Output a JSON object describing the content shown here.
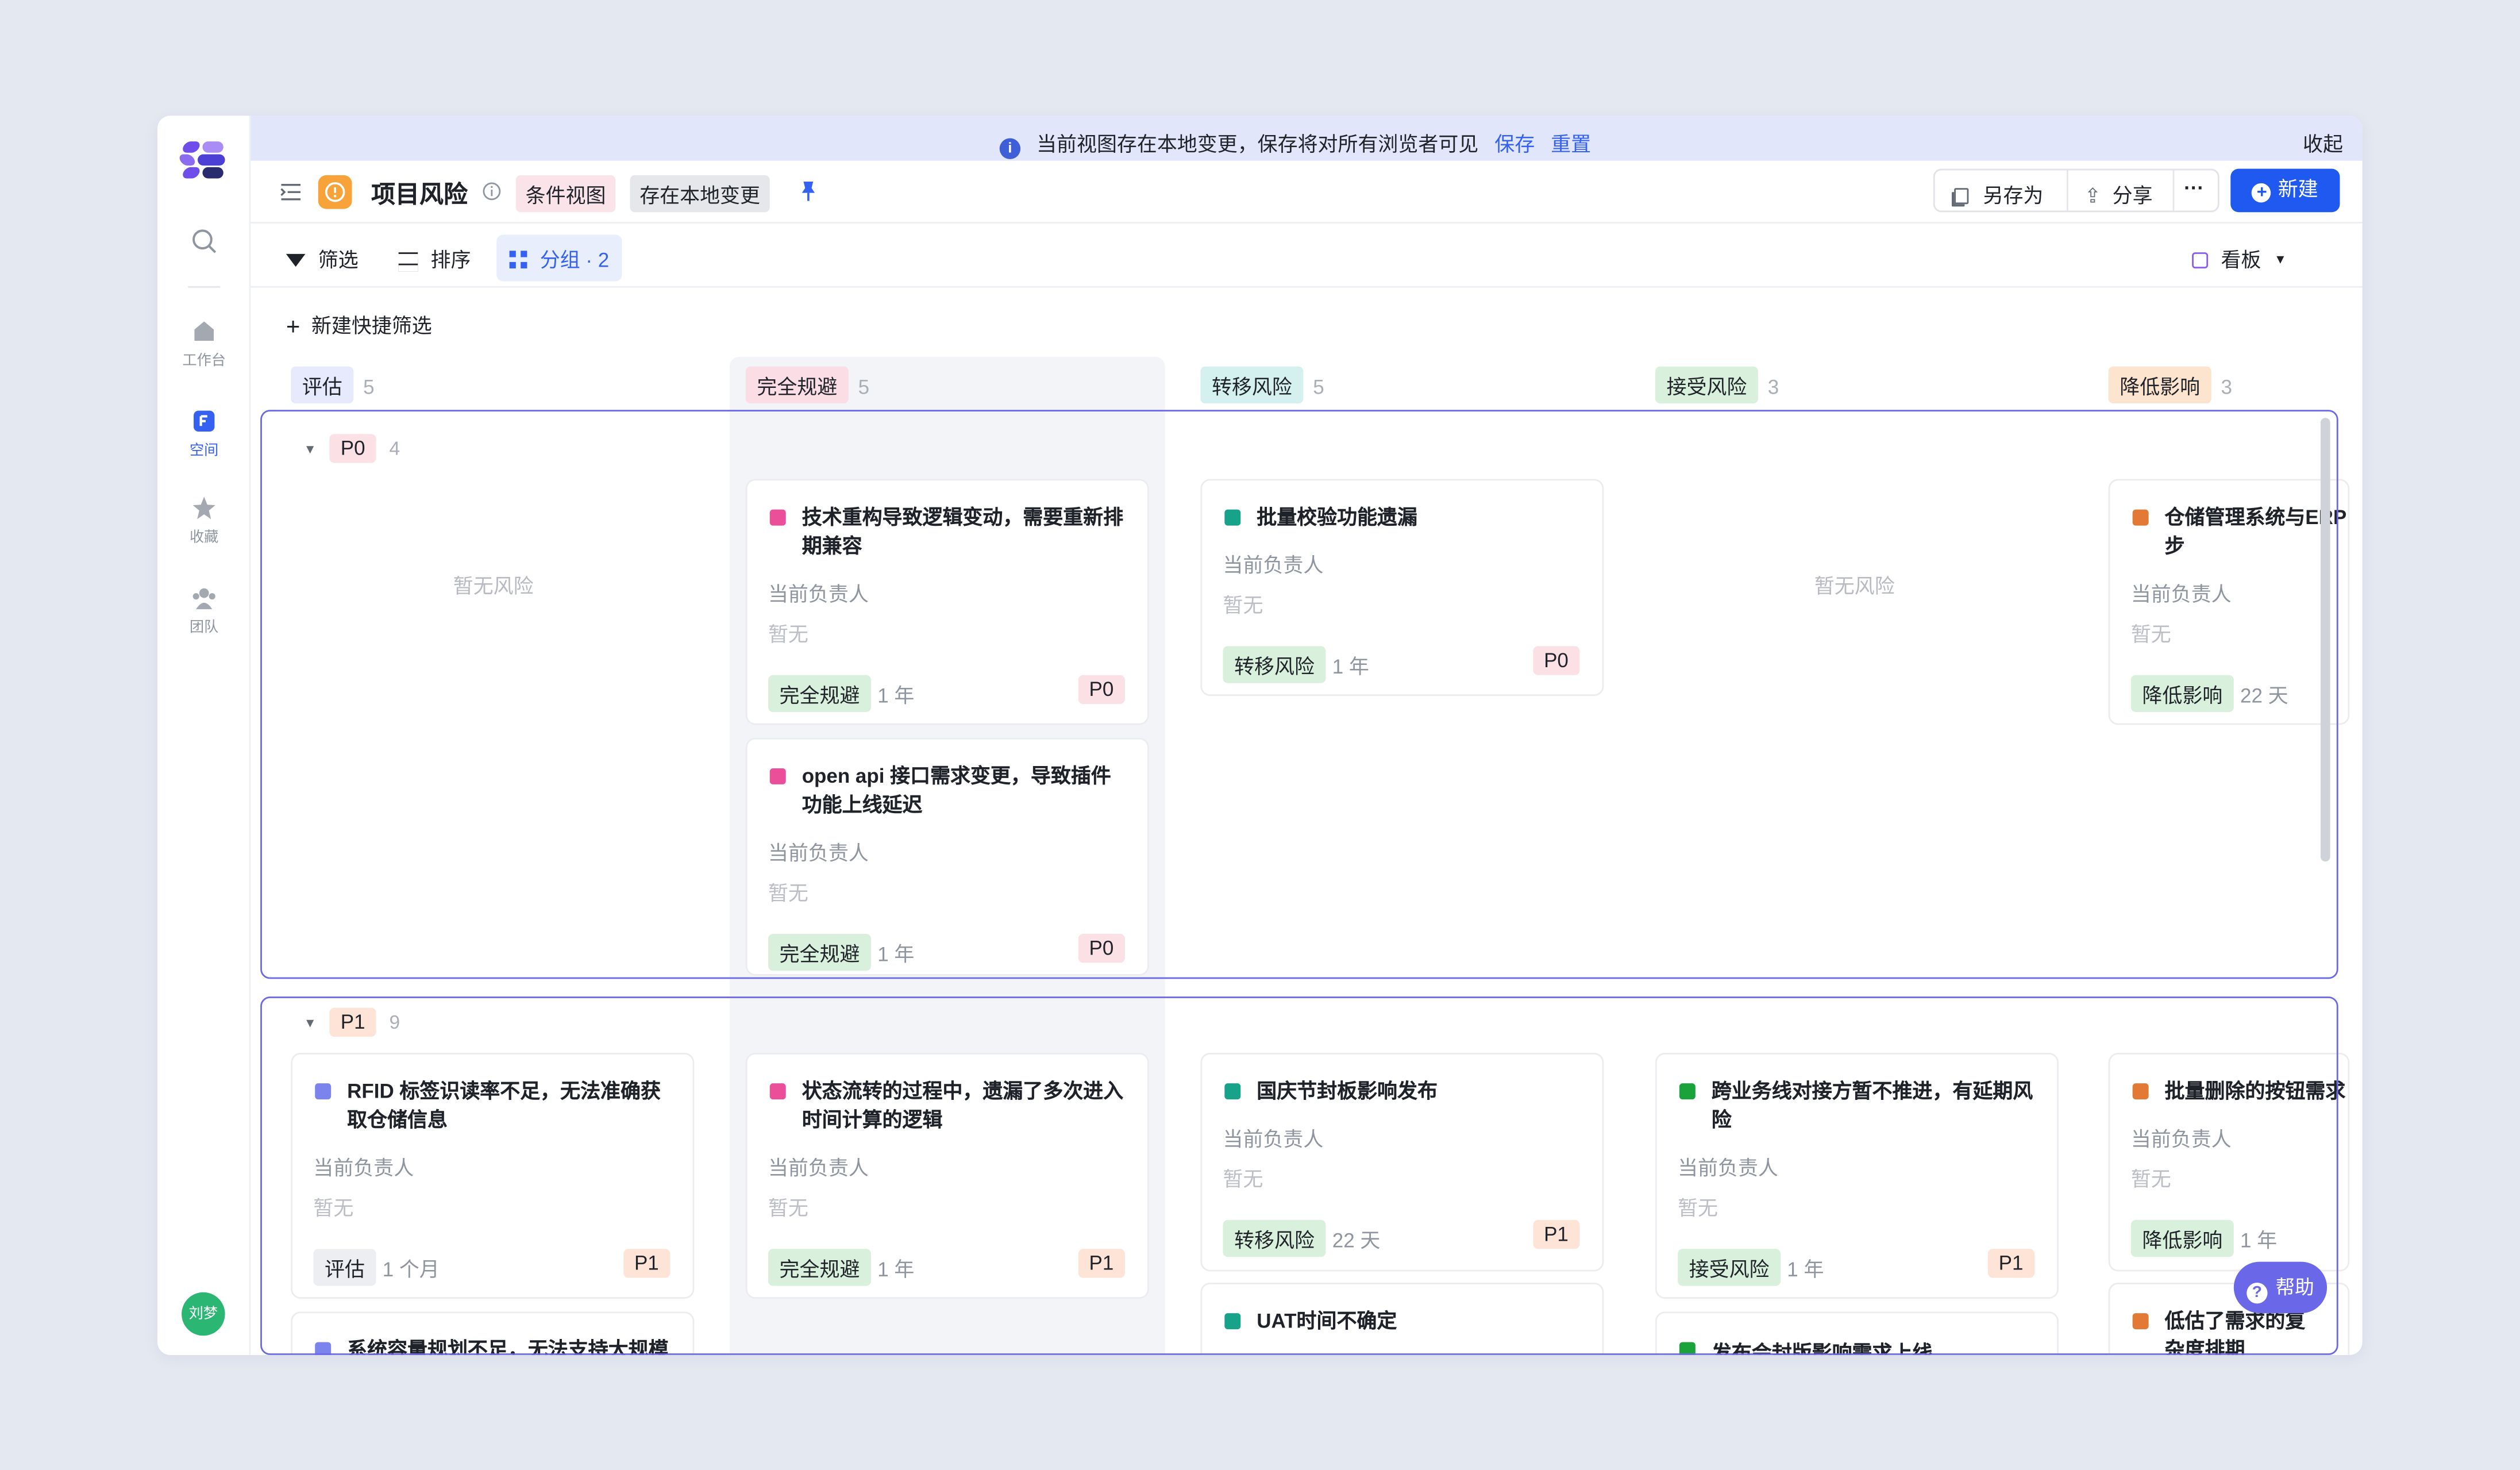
{
  "sidebar": {
    "items": [
      {
        "label": "工作台"
      },
      {
        "label": "空间"
      },
      {
        "label": "收藏"
      },
      {
        "label": "团队"
      }
    ],
    "avatar_label": "刘梦"
  },
  "banner": {
    "message": "当前视图存在本地变更，保存将对所有浏览者可见",
    "save_label": "保存",
    "reset_label": "重置",
    "collapse_label": "收起"
  },
  "header": {
    "title": "项目风险",
    "view_tag": "条件视图",
    "local_change_tag": "存在本地变更",
    "save_as_label": "另存为",
    "share_label": "分享",
    "more_label": "···",
    "new_label": "新建"
  },
  "toolbar": {
    "filter_label": "筛选",
    "sort_label": "排序",
    "group_label": "分组 · 2",
    "view_label": "看板"
  },
  "quick_filter_label": "新建快捷筛选",
  "columns": [
    {
      "name": "评估",
      "count": "5",
      "color": "#e7e9fd"
    },
    {
      "name": "完全规避",
      "count": "5",
      "color": "#fbdde6"
    },
    {
      "name": "转移风险",
      "count": "5",
      "color": "#d5f1ef"
    },
    {
      "name": "接受风险",
      "count": "3",
      "color": "#d9f1dc"
    },
    {
      "name": "降低影响",
      "count": "3",
      "color": "#fde4cf"
    }
  ],
  "groups": [
    {
      "name": "P0",
      "count": "4",
      "color": "#fbe1e6"
    },
    {
      "name": "P1",
      "count": "9",
      "color": "#fde4d6"
    }
  ],
  "empty_label": "暂无风险",
  "owner_label": "当前负责人",
  "owner_empty": "暂无",
  "cards": [
    {
      "title": "技术重构导致逻辑变动，需要重新排期兼容",
      "status": "完全规避",
      "time": "1 年",
      "priority": "P0",
      "dot": "#eb4f9a",
      "status_color": "#d9f1dc"
    },
    {
      "title": "open api 接口需求变更，导致插件功能上线延迟",
      "status": "完全规避",
      "time": "1 年",
      "priority": "P0",
      "dot": "#eb4f9a",
      "status_color": "#d9f1dc"
    },
    {
      "title": "批量校验功能遗漏",
      "status": "转移风险",
      "time": "1 年",
      "priority": "P0",
      "dot": "#17a38a",
      "status_color": "#d9f1dc"
    },
    {
      "title": "仓储管理系统与ERP，无法实现数据同步",
      "status": "降低影响",
      "time": "22 天",
      "priority": "",
      "dot": "#e27a35",
      "status_color": "#d9f1dc"
    },
    {
      "title": "RFID 标签识读率不足，无法准确获取仓储信息",
      "status": "评估",
      "time": "1 个月",
      "priority": "P1",
      "dot": "#7b83ec",
      "status_color": "#eceef2"
    },
    {
      "title": "状态流转的过程中，遗漏了多次进入时间计算的逻辑",
      "status": "完全规避",
      "time": "1 年",
      "priority": "P1",
      "dot": "#eb4f9a",
      "status_color": "#d9f1dc"
    },
    {
      "title": "国庆节封板影响发布",
      "status": "转移风险",
      "time": "22 天",
      "priority": "P1",
      "dot": "#17a38a",
      "status_color": "#d9f1dc"
    },
    {
      "title": "跨业务线对接方暂不推进，有延期风险",
      "status": "接受风险",
      "time": "1 年",
      "priority": "P1",
      "dot": "#1aa33b",
      "status_color": "#d9f1dc"
    },
    {
      "title": "批量删除的按钮需求",
      "status": "降低影响",
      "time": "1 年",
      "priority": "",
      "dot": "#e27a35",
      "status_color": "#d9f1dc"
    },
    {
      "title": "系统容量规划不足，无法支持大规模",
      "dot": "#7b83ec"
    },
    {
      "title": "UAT时间不确定",
      "dot": "#17a38a"
    },
    {
      "title": "发布会封版影响需求上线",
      "dot": "#1aa33b"
    },
    {
      "title": "低估了需求的复杂度排期",
      "dot": "#e27a35"
    }
  ],
  "priority_color": "#fde4d6",
  "p0_color": "#fbe1e6",
  "help_label": "帮助"
}
